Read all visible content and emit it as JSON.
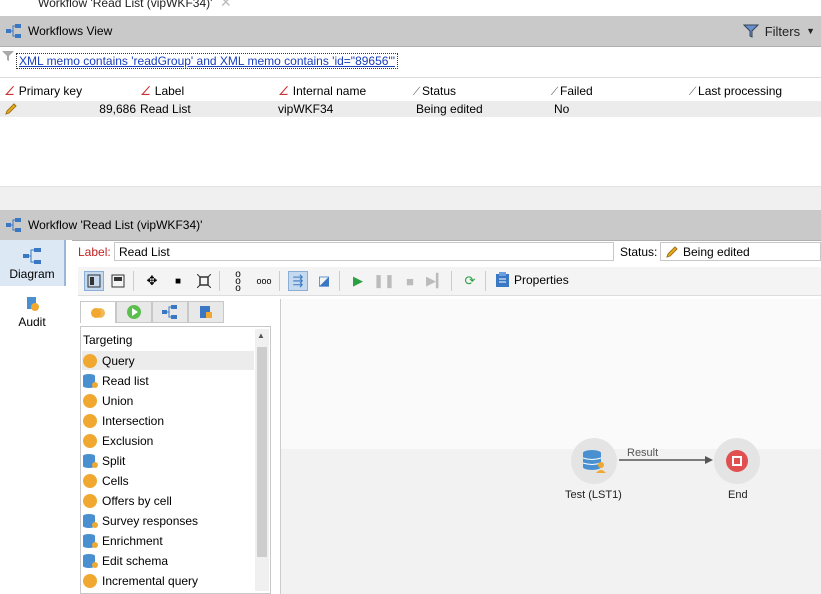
{
  "window": {
    "title": "Workflow 'Read List (vipWKF34)'"
  },
  "workflows_view": {
    "title": "Workflows View",
    "filters_label": "Filters",
    "filter_expression": "XML memo contains 'readGroup' and XML memo contains 'id=\"89656\"'",
    "columns": [
      "Primary key",
      "Label",
      "Internal name",
      "Status",
      "Failed",
      "Last processing"
    ],
    "rows": [
      {
        "primary_key": "89,686",
        "label": "Read List",
        "internal_name": "vipWKF34",
        "status": "Being edited",
        "failed": "No",
        "last_processing": ""
      }
    ]
  },
  "workflow_editor": {
    "title": "Workflow 'Read List (vipWKF34)'",
    "nav": [
      {
        "label": "Diagram",
        "icon": "diagram-icon"
      },
      {
        "label": "Audit",
        "icon": "audit-icon"
      }
    ],
    "label_caption": "Label:",
    "label_value": "Read List",
    "status_caption": "Status:",
    "status_value": "Being edited",
    "properties_label": "Properties",
    "palette": {
      "category": "Targeting",
      "items": [
        {
          "label": "Query",
          "icon": "query-icon",
          "color": "#f0a830"
        },
        {
          "label": "Read list",
          "icon": "read-list-icon",
          "color": "#4a90d0"
        },
        {
          "label": "Union",
          "icon": "union-icon",
          "color": "#f0a830"
        },
        {
          "label": "Intersection",
          "icon": "intersection-icon",
          "color": "#f0a830"
        },
        {
          "label": "Exclusion",
          "icon": "exclusion-icon",
          "color": "#f0a830"
        },
        {
          "label": "Split",
          "icon": "split-icon",
          "color": "#4a90d0"
        },
        {
          "label": "Cells",
          "icon": "cells-icon",
          "color": "#f0a830"
        },
        {
          "label": "Offers by cell",
          "icon": "offers-icon",
          "color": "#f0a830"
        },
        {
          "label": "Survey responses",
          "icon": "survey-icon",
          "color": "#4a90d0"
        },
        {
          "label": "Enrichment",
          "icon": "enrichment-icon",
          "color": "#4a90d0"
        },
        {
          "label": "Edit schema",
          "icon": "edit-schema-icon",
          "color": "#4a90d0"
        },
        {
          "label": "Incremental query",
          "icon": "incremental-query-icon",
          "color": "#f0a830"
        }
      ]
    },
    "diagram": {
      "nodes": [
        {
          "label": "Test (LST1)",
          "icon": "read-list-icon"
        },
        {
          "label": "End",
          "icon": "stop-icon"
        }
      ],
      "transition_label": "Result"
    }
  },
  "colors": {
    "header_bg": "#c9c9c9",
    "link": "#1a3fbf",
    "accent": "#4a90d0",
    "orange": "#f0a830",
    "end_red": "#e05050"
  }
}
